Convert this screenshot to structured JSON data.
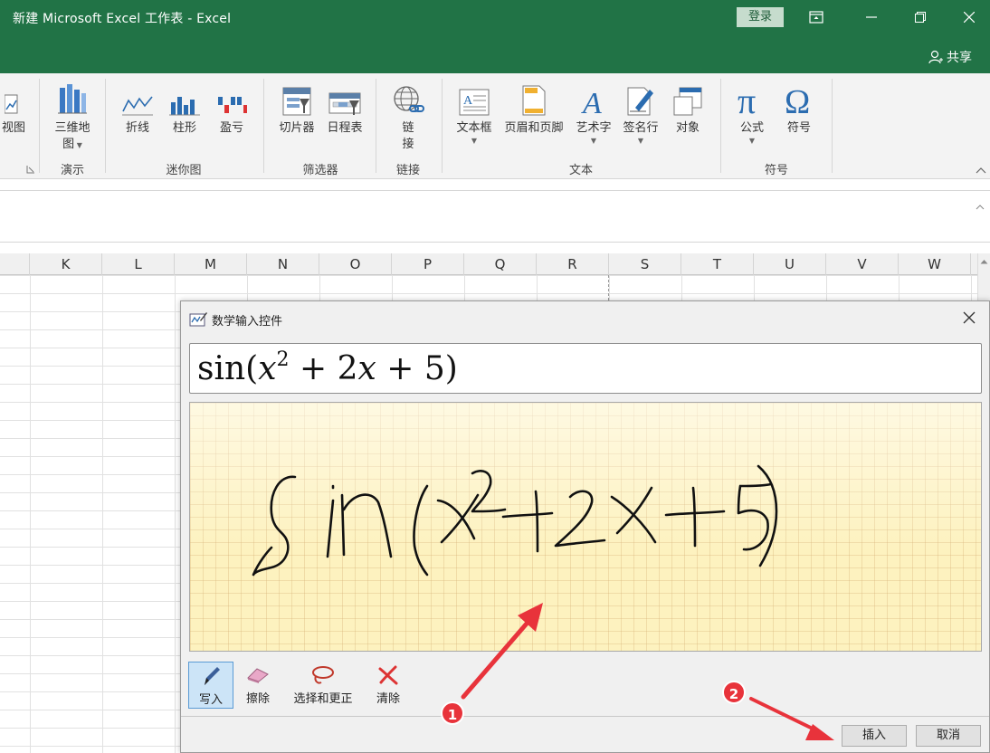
{
  "window": {
    "title": "新建 Microsoft Excel 工作表  -  Excel",
    "login_label": "登录",
    "share_label": "共享"
  },
  "ribbon": {
    "buttons": {
      "view_chart": "视图",
      "map3d": "三维地",
      "map3d_2": "图",
      "line": "折线",
      "column": "柱形",
      "winloss": "盈亏",
      "slicer": "切片器",
      "timeline": "日程表",
      "link": "链",
      "link_2": "接",
      "textbox": "文本框",
      "header_footer": "页眉和页脚",
      "wordart": "艺术字",
      "signature": "签名行",
      "object": "对象",
      "equation": "公式",
      "symbol": "符号"
    },
    "groups": {
      "tours": "演示",
      "sparklines": "迷你图",
      "filters": "筛选器",
      "links": "链接",
      "text": "文本",
      "symbols": "符号"
    }
  },
  "sheet": {
    "columns": [
      "K",
      "L",
      "M",
      "N",
      "O",
      "P",
      "Q",
      "R",
      "S",
      "T",
      "U",
      "V",
      "W"
    ]
  },
  "dialog": {
    "title": "数学输入控件",
    "preview": {
      "prefix": "sin(",
      "var1": "x",
      "exponent": "2",
      "middle": " + 2",
      "var2": "x",
      "suffix": " + 5)"
    },
    "tools": {
      "write": "写入",
      "erase": "擦除",
      "select_correct": "选择和更正",
      "clear": "清除"
    },
    "insert_label": "插入",
    "cancel_label": "取消"
  },
  "annotations": {
    "step1": "1",
    "step2": "2",
    "accent_color": "#e8333b"
  },
  "colors": {
    "excel_green": "#217346",
    "ribbon_bg": "#f3f3f3",
    "canvas_bg": "#fdf2bf"
  }
}
